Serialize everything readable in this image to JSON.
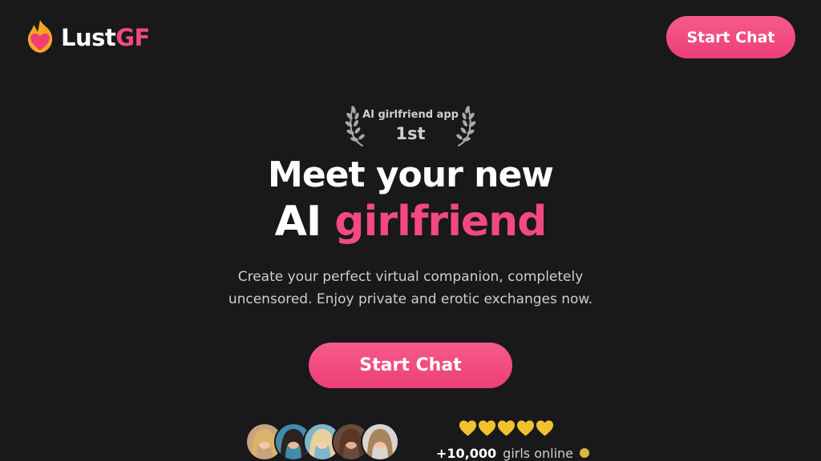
{
  "header": {
    "logo_text_main": "Lust",
    "logo_text_accent": "GF",
    "start_chat_label": "Start Chat"
  },
  "award": {
    "label": "AI girlfriend app",
    "rank": "1st"
  },
  "hero": {
    "headline_line1": "Meet your new",
    "headline_line2_plain": "AI",
    "headline_line2_accent": "girlfriend",
    "subtitle": "Create your perfect virtual companion, completely uncensored. Enjoy private and erotic exchanges now.",
    "cta_label": "Start Chat"
  },
  "social_proof": {
    "avatars": [
      "avatar-1",
      "avatar-2",
      "avatar-3",
      "avatar-4",
      "avatar-5"
    ],
    "rating_hearts": 5,
    "online_count": "+10,000",
    "online_label": "girls online",
    "online_status_color": "#d8b844"
  },
  "colors": {
    "background": "#19181a",
    "accent": "#f24a7e",
    "button": "#ef4a7c",
    "heart": "#f2c22e"
  },
  "icons": {
    "logo": "flame-heart-icon",
    "laurel": "laurel-icon",
    "rating": "heart-icon"
  }
}
